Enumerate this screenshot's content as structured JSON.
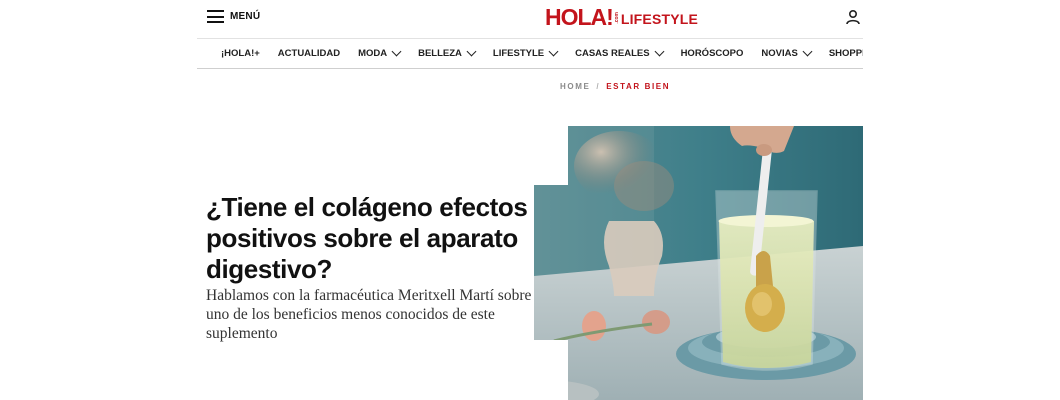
{
  "header": {
    "menu_label": "MENÚ",
    "logo": {
      "brand": "HOLA!",
      "suffix": ".com",
      "section": "LIFESTYLE"
    },
    "user_icon": "user-icon"
  },
  "nav": {
    "items": [
      {
        "label": "¡HOLA!+",
        "dropdown": false
      },
      {
        "label": "ACTUALIDAD",
        "dropdown": false
      },
      {
        "label": "MODA",
        "dropdown": true
      },
      {
        "label": "BELLEZA",
        "dropdown": true
      },
      {
        "label": "LIFESTYLE",
        "dropdown": true
      },
      {
        "label": "CASAS REALES",
        "dropdown": true
      },
      {
        "label": "HORÓSCOPO",
        "dropdown": false
      },
      {
        "label": "NOVIAS",
        "dropdown": true
      },
      {
        "label": "SHOPPING",
        "dropdown": false
      }
    ]
  },
  "breadcrumb": {
    "home": "HOME",
    "separator": "/",
    "current": "ESTAR BIEN"
  },
  "article": {
    "headline": "¿Tiene el colágeno efectos positivos sobre el aparato digestivo?",
    "subhead": "Hablamos con la farmacéutica Meritxell Martí sobre uno de los beneficios menos conocidos de este suplemento"
  },
  "colors": {
    "brand_red": "#c3141c",
    "nav_text": "#222222",
    "image_teal": "#3f7f8a"
  }
}
